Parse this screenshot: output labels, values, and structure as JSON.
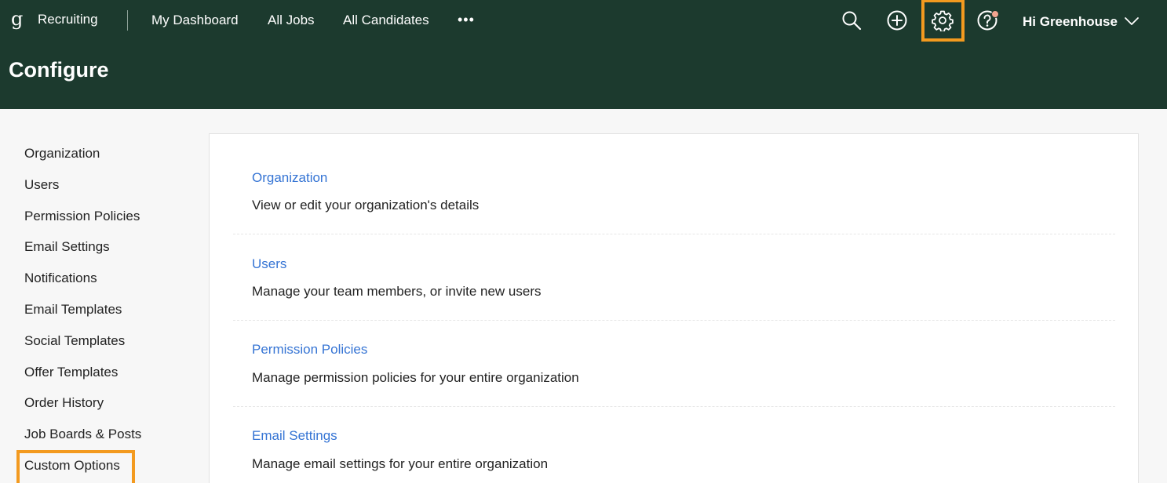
{
  "app": {
    "logo_glyph": "g",
    "name": "Recruiting"
  },
  "nav": {
    "links": [
      "My Dashboard",
      "All Jobs",
      "All Candidates"
    ],
    "more": "•••"
  },
  "header_icons": [
    "search-icon",
    "plus-circle-icon",
    "gear-icon",
    "help-icon"
  ],
  "user": {
    "greeting": "Hi Greenhouse"
  },
  "page": {
    "title": "Configure"
  },
  "sidebar": {
    "items": [
      "Organization",
      "Users",
      "Permission Policies",
      "Email Settings",
      "Notifications",
      "Email Templates",
      "Social Templates",
      "Offer Templates",
      "Order History",
      "Job Boards & Posts",
      "Custom Options"
    ],
    "highlighted": "Custom Options"
  },
  "sections": [
    {
      "title": "Organization",
      "description": "View or edit your organization's details"
    },
    {
      "title": "Users",
      "description": "Manage your team members, or invite new users"
    },
    {
      "title": "Permission Policies",
      "description": "Manage permission policies for your entire organization"
    },
    {
      "title": "Email Settings",
      "description": "Manage email settings for your entire organization"
    }
  ],
  "colors": {
    "header_bg": "#1c3a2e",
    "link": "#3574d4",
    "highlight": "#f39a1f",
    "notification_dot": "#f2a590"
  }
}
